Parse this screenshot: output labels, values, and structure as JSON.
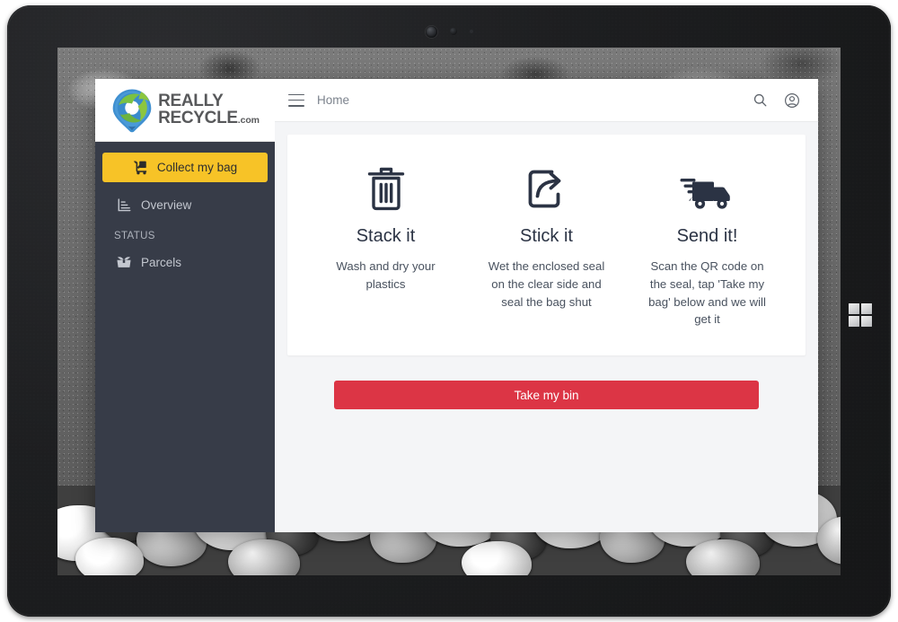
{
  "device": {
    "type": "windows-tablet",
    "os_logo": "windows-logo",
    "camera": "front-camera"
  },
  "wallpaper": {
    "description": "grayscale rocks and pebbles photo"
  },
  "app": {
    "brand": {
      "line1": "REALLY",
      "line2": "RECYCLE",
      "tld": ".com",
      "logo_icon": "recycle-pin-logo"
    },
    "sidebar": {
      "primary_action": {
        "label": "Collect my bag",
        "icon": "hand-truck-icon"
      },
      "items": [
        {
          "label": "Overview",
          "icon": "bar-chart-icon"
        }
      ],
      "section_label": "STATUS",
      "status_items": [
        {
          "label": "Parcels",
          "icon": "open-box-icon"
        }
      ]
    },
    "topbar": {
      "menu_icon": "hamburger-icon",
      "breadcrumb": "Home",
      "search_icon": "search-icon",
      "account_icon": "user-circle-icon"
    },
    "steps": [
      {
        "icon": "trash-bin-icon",
        "title": "Stack it",
        "description": "Wash and dry your plastics"
      },
      {
        "icon": "share-export-icon",
        "title": "Stick it",
        "description": "Wet the enclosed seal on the clear side and seal the bag shut"
      },
      {
        "icon": "delivery-truck-icon",
        "title": "Send it!",
        "description": "Scan the QR code on the seal, tap 'Take my bag' below and we will get it"
      }
    ],
    "cta": {
      "label": "Take my bin"
    },
    "colors": {
      "sidebar": "#373c48",
      "primary_action": "#f7c327",
      "cta": "#dc3545",
      "content_bg": "#f4f5f7",
      "card_bg": "#ffffff",
      "heading": "#2b3344"
    }
  }
}
